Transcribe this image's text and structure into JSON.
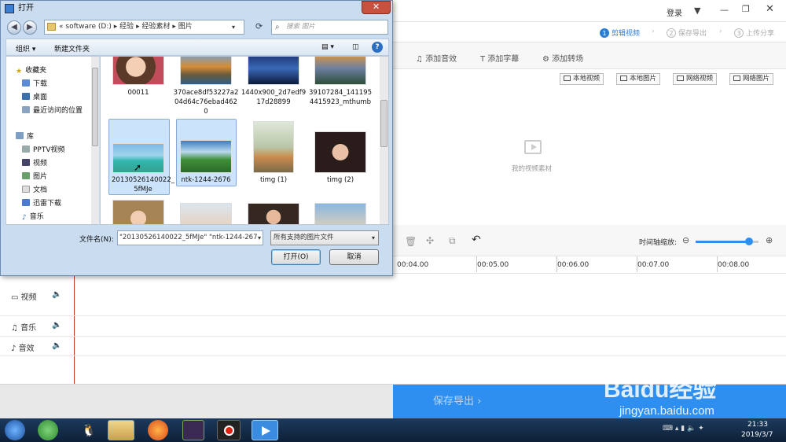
{
  "app": {
    "login": "登录",
    "steps": [
      {
        "num": "1",
        "label": "剪辑视频"
      },
      {
        "num": "2",
        "label": "保存导出"
      },
      {
        "num": "3",
        "label": "上传分享"
      }
    ],
    "tabs": [
      "添加音效",
      "添加字幕",
      "添加转场"
    ],
    "media_buttons": [
      "本地视频",
      "本地图片",
      "网络视频",
      "网络图片"
    ],
    "media_empty": "我的视频素材",
    "zoom_label": "时间轴缩放:",
    "zoom_level": 0.85,
    "timeline_ticks": [
      "00:04.00",
      "00:05.00",
      "00:06.00",
      "00:07.00",
      "00:08.00"
    ],
    "tracks": [
      "视频",
      "音乐",
      "音效"
    ],
    "export_button": "保存导出"
  },
  "dialog": {
    "title": "打开",
    "breadcrumb": [
      "«",
      "software (D:)",
      "▸",
      "经验",
      "▸",
      "经验素材",
      "▸",
      "图片"
    ],
    "search_placeholder": "搜索 图片",
    "organize": "组织 ▾",
    "new_folder": "新建文件夹",
    "nav": {
      "favorites_header": "收藏夹",
      "favorites": [
        "下载",
        "桌面",
        "最近访问的位置"
      ],
      "library_header": "库",
      "library": [
        "PPTV视频",
        "视频",
        "图片",
        "文档",
        "迅雷下载",
        "音乐"
      ]
    },
    "files": [
      {
        "name": "00011",
        "selected": false
      },
      {
        "name": "370ace8df53227a204d64c76ebad4620",
        "selected": false
      },
      {
        "name": "1440x900_2d7edf917d28899",
        "selected": false
      },
      {
        "name": "39107284_1411954415923_mthumb",
        "selected": false
      },
      {
        "name": "20130526140022_5fMJe",
        "selected": true
      },
      {
        "name": "ntk-1244-2676",
        "selected": true
      },
      {
        "name": "timg (1)",
        "selected": false
      },
      {
        "name": "timg (2)",
        "selected": false
      }
    ],
    "filename_label": "文件名(N):",
    "filename_value": "\"20130526140022_5fMJe\" \"ntk-1244-267",
    "filetype_value": "所有支持的图片文件",
    "open_button": "打开(O)",
    "cancel_button": "取消"
  },
  "taskbar": {
    "time": "21:33",
    "date": "2019/3/7"
  },
  "watermark": {
    "brand": "Baidu经验",
    "url": "jingyan.baidu.com"
  }
}
